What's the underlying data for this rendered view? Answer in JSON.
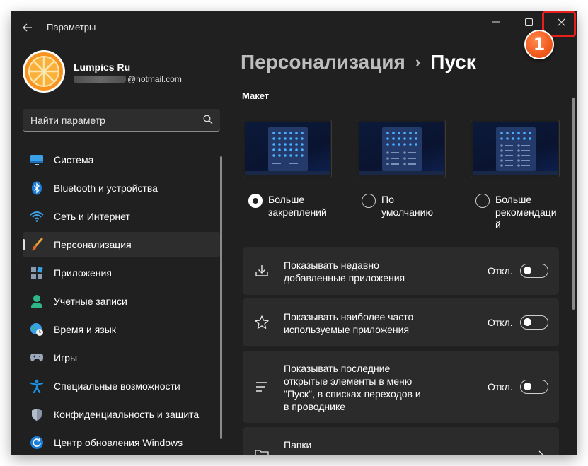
{
  "window": {
    "title": "Параметры"
  },
  "step_badge": "1",
  "user": {
    "name": "Lumpics Ru",
    "email_suffix": "@hotmail.com"
  },
  "search": {
    "placeholder": "Найти параметр"
  },
  "sidebar": {
    "items": [
      {
        "label": "Система",
        "icon": "system-icon",
        "active": false
      },
      {
        "label": "Bluetooth и устройства",
        "icon": "bluetooth-icon",
        "active": false
      },
      {
        "label": "Сеть и Интернет",
        "icon": "wifi-icon",
        "active": false
      },
      {
        "label": "Персонализация",
        "icon": "brush-icon",
        "active": true
      },
      {
        "label": "Приложения",
        "icon": "apps-icon",
        "active": false
      },
      {
        "label": "Учетные записи",
        "icon": "account-icon",
        "active": false
      },
      {
        "label": "Время и язык",
        "icon": "time-language-icon",
        "active": false
      },
      {
        "label": "Игры",
        "icon": "gamepad-icon",
        "active": false
      },
      {
        "label": "Специальные возможности",
        "icon": "accessibility-icon",
        "active": false
      },
      {
        "label": "Конфиденциальность и защита",
        "icon": "shield-icon",
        "active": false
      },
      {
        "label": "Центр обновления Windows",
        "icon": "update-icon",
        "active": false
      }
    ]
  },
  "breadcrumb": {
    "parent": "Персонализация",
    "separator": "›",
    "current": "Пуск"
  },
  "layout": {
    "title": "Макет",
    "options": [
      {
        "line1": "Больше",
        "line2": "закреплений",
        "line3": "",
        "checked": true
      },
      {
        "line1": "По",
        "line2": "умолчанию",
        "line3": "",
        "checked": false
      },
      {
        "line1": "Больше",
        "line2": "рекомендаци",
        "line3": "й",
        "checked": false
      }
    ]
  },
  "settings": [
    {
      "line1": "Показывать недавно",
      "line2": "добавленные приложения",
      "line3": "",
      "line4": "",
      "state": "Откл.",
      "icon": "download-icon"
    },
    {
      "line1": "Показывать наиболее часто",
      "line2": "используемые приложения",
      "line3": "",
      "line4": "",
      "state": "Откл.",
      "icon": "star-icon"
    },
    {
      "line1": "Показывать последние",
      "line2": "открытые элементы в меню",
      "line3": "\"Пуск\", в списках переходов и",
      "line4": "в проводнике",
      "state": "Откл.",
      "icon": "list-icon"
    },
    {
      "line1": "Папки",
      "line2": "",
      "line3": "",
      "line4": "",
      "state": "",
      "icon": "folder-icon"
    }
  ],
  "colors": {
    "window_bg": "#202020",
    "card_bg": "#2b2b2b",
    "highlight": "#e8201c",
    "badge": "#f05a1c"
  }
}
